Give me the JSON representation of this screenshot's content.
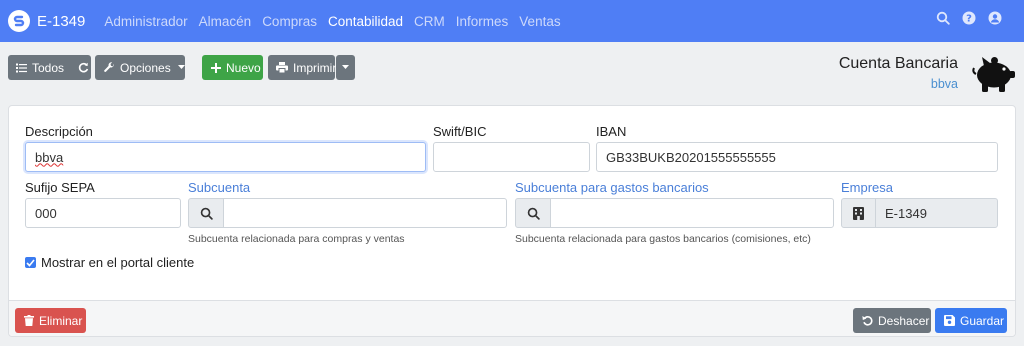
{
  "app": {
    "title": "E-1349"
  },
  "nav": {
    "items": [
      {
        "label": "Administrador",
        "active": false
      },
      {
        "label": "Almacén",
        "active": false
      },
      {
        "label": "Compras",
        "active": false
      },
      {
        "label": "Contabilidad",
        "active": true
      },
      {
        "label": "CRM",
        "active": false
      },
      {
        "label": "Informes",
        "active": false
      },
      {
        "label": "Ventas",
        "active": false
      }
    ],
    "icons": [
      "search-icon",
      "help-icon",
      "user-icon"
    ]
  },
  "toolbar": {
    "todos_label": "Todos",
    "opciones_label": "Opciones",
    "nuevo_label": "Nuevo",
    "imprimir_label": "Imprimir"
  },
  "header": {
    "title": "Cuenta Bancaria",
    "subtitle": "bbva"
  },
  "form": {
    "descripcion": {
      "label": "Descripción",
      "value": "bbva"
    },
    "swift": {
      "label": "Swift/BIC",
      "value": ""
    },
    "iban": {
      "label": "IBAN",
      "value": "GB33BUKB20201555555555"
    },
    "sufijo": {
      "label": "Sufijo SEPA",
      "value": "000"
    },
    "subcuenta": {
      "label": "Subcuenta",
      "value": "",
      "help": "Subcuenta relacionada para compras y ventas"
    },
    "subcuenta_gastos": {
      "label": "Subcuenta para gastos bancarios",
      "value": "",
      "help": "Subcuenta relacionada para gastos bancarios (comisiones, etc)"
    },
    "empresa": {
      "label": "Empresa",
      "value": "E-1349"
    },
    "portal": {
      "label": "Mostrar en el portal cliente",
      "checked": true
    }
  },
  "footer": {
    "eliminar_label": "Eliminar",
    "deshacer_label": "Deshacer",
    "guardar_label": "Guardar"
  },
  "colors": {
    "navbar": "#4f7ef5",
    "primary": "#3a7bf0",
    "success": "#3ea447",
    "danger": "#d9534f",
    "secondary": "#6c757d"
  }
}
